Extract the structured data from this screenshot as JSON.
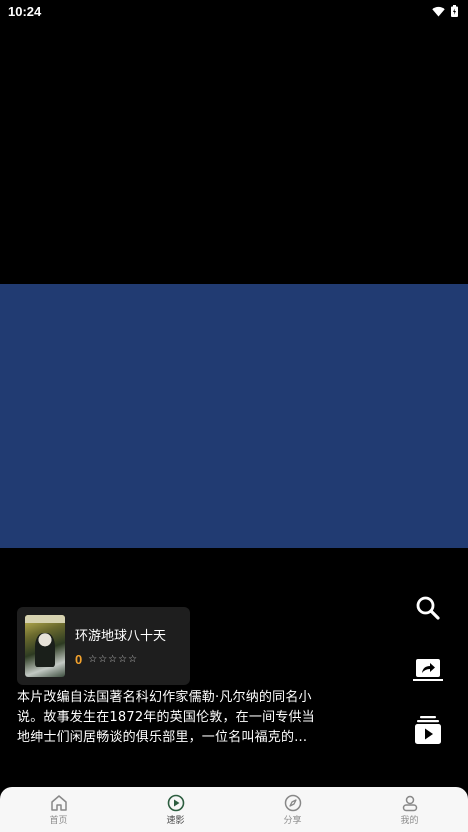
{
  "status": {
    "time": "10:24"
  },
  "movie": {
    "title": "环游地球八十天",
    "score": "0",
    "stars": [
      "☆",
      "☆",
      "☆",
      "☆",
      "☆"
    ],
    "description": "本片改编自法国著名科幻作家儒勒·凡尔纳的同名小说。故事发生在1872年的英国伦敦，在一间专供当地绅士们闲居畅谈的俱乐部里，一位名叫福克的..."
  },
  "colors": {
    "video_background": "#213b72",
    "score_color": "#f3a22d"
  },
  "side_actions": [
    {
      "icon": "search-icon"
    },
    {
      "icon": "share-icon"
    },
    {
      "icon": "playlist-icon"
    }
  ],
  "tabs": [
    {
      "label": "首页",
      "icon": "home-icon"
    },
    {
      "label": "速影",
      "icon": "play-circle-icon"
    },
    {
      "label": "分享",
      "icon": "compass-icon"
    },
    {
      "label": "我的",
      "icon": "user-icon"
    }
  ]
}
